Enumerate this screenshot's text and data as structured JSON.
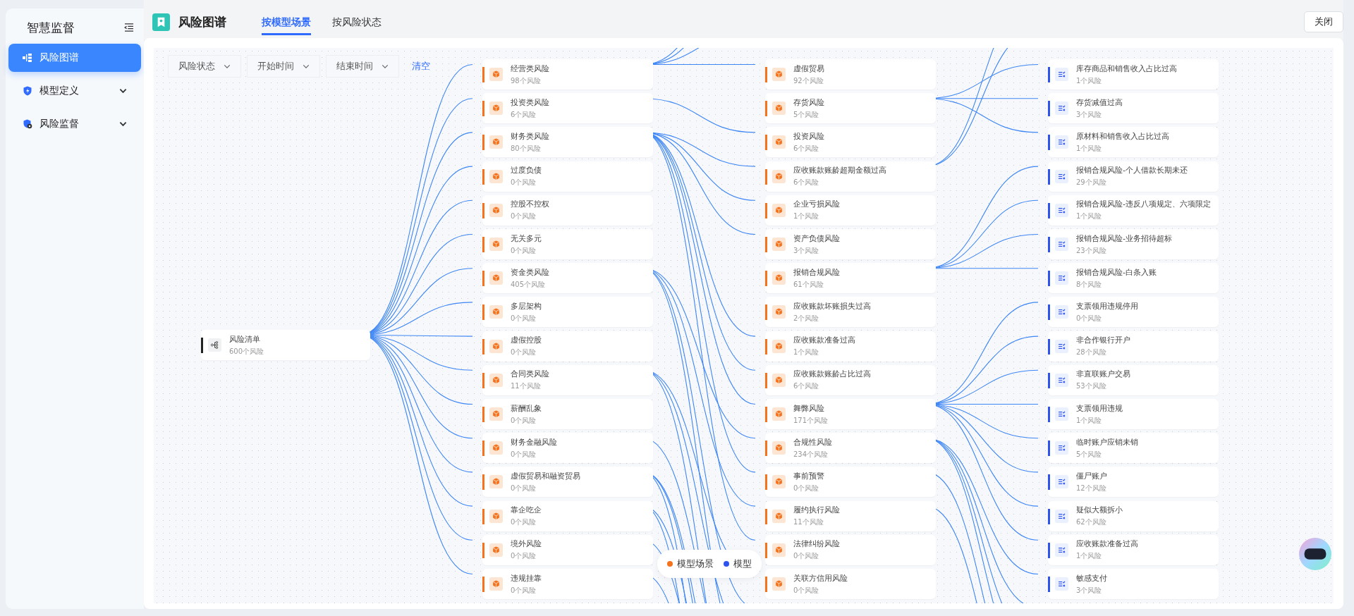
{
  "sidebar": {
    "title": "智慧监督",
    "items": [
      {
        "label": "风险图谱",
        "selected": true,
        "expandable": false
      },
      {
        "label": "模型定义",
        "selected": false,
        "expandable": true
      },
      {
        "label": "风险监督",
        "selected": false,
        "expandable": true
      }
    ]
  },
  "header": {
    "title": "风险图谱",
    "tabs": [
      {
        "label": "按模型场景",
        "selected": true
      },
      {
        "label": "按风险状态",
        "selected": false
      }
    ],
    "close": "关闭"
  },
  "filters": [
    {
      "label": "风险状态"
    },
    {
      "label": "开始时间"
    },
    {
      "label": "结束时间"
    }
  ],
  "clear": "清空",
  "graph": {
    "root": {
      "name": "风险清单",
      "count": "600个风险"
    },
    "columns": [
      {
        "kind": "scene",
        "nodes": [
          {
            "name": "经营类风险",
            "count": "98个风险"
          },
          {
            "name": "投资类风险",
            "count": "6个风险"
          },
          {
            "name": "财务类风险",
            "count": "80个风险"
          },
          {
            "name": "过度负债",
            "count": "0个风险"
          },
          {
            "name": "控股不控权",
            "count": "0个风险"
          },
          {
            "name": "无关多元",
            "count": "0个风险"
          },
          {
            "name": "资金类风险",
            "count": "405个风险"
          },
          {
            "name": "多层架构",
            "count": "0个风险"
          },
          {
            "name": "虚假控股",
            "count": "0个风险"
          },
          {
            "name": "合同类风险",
            "count": "11个风险"
          },
          {
            "name": "薪酬乱象",
            "count": "0个风险"
          },
          {
            "name": "财务金融风险",
            "count": "0个风险"
          },
          {
            "name": "虚假贸易和融资贸易",
            "count": "0个风险"
          },
          {
            "name": "靠企吃企",
            "count": "0个风险"
          },
          {
            "name": "境外风险",
            "count": "0个风险"
          },
          {
            "name": "违规挂靠",
            "count": "0个风险"
          }
        ]
      },
      {
        "kind": "scene",
        "nodes": [
          {
            "name": "虚假贸易",
            "count": "92个风险"
          },
          {
            "name": "存货风险",
            "count": "5个风险"
          },
          {
            "name": "投资风险",
            "count": "6个风险"
          },
          {
            "name": "应收账款账龄超期金额过高",
            "count": "6个风险"
          },
          {
            "name": "企业亏损风险",
            "count": "1个风险"
          },
          {
            "name": "资产负债风险",
            "count": "3个风险"
          },
          {
            "name": "报销合规风险",
            "count": "61个风险"
          },
          {
            "name": "应收账款坏账损失过高",
            "count": "2个风险"
          },
          {
            "name": "应收账款准备过高",
            "count": "1个风险"
          },
          {
            "name": "应收账款账龄占比过高",
            "count": "6个风险"
          },
          {
            "name": "舞弊风险",
            "count": "171个风险"
          },
          {
            "name": "合规性风险",
            "count": "234个风险"
          },
          {
            "name": "事前预警",
            "count": "0个风险"
          },
          {
            "name": "履约执行风险",
            "count": "11个风险"
          },
          {
            "name": "法律纠纷风险",
            "count": "0个风险"
          },
          {
            "name": "关联方信用风险",
            "count": "0个风险"
          }
        ]
      },
      {
        "kind": "model",
        "nodes": [
          {
            "name": "库存商品和销售收入占比过高",
            "count": "1个风险"
          },
          {
            "name": "存货减值过高",
            "count": "3个风险"
          },
          {
            "name": "原材料和销售收入占比过高",
            "count": "1个风险"
          },
          {
            "name": "报销合规风险-个人借款长期未还",
            "count": "29个风险"
          },
          {
            "name": "报销合规风险-违反八项规定、六项限定",
            "count": "1个风险"
          },
          {
            "name": "报销合规风险-业务招待超标",
            "count": "23个风险"
          },
          {
            "name": "报销合规风险-白条入账",
            "count": "8个风险"
          },
          {
            "name": "支票领用违规停用",
            "count": "0个风险"
          },
          {
            "name": "非合作银行开户",
            "count": "28个风险"
          },
          {
            "name": "非直联账户交易",
            "count": "53个风险"
          },
          {
            "name": "支票领用违规",
            "count": "1个风险"
          },
          {
            "name": "临时账户应销未销",
            "count": "5个风险"
          },
          {
            "name": "僵尸账户",
            "count": "12个风险"
          },
          {
            "name": "疑似大额拆小",
            "count": "62个风险"
          },
          {
            "name": "应收账款准备过高",
            "count": "1个风险"
          },
          {
            "name": "敏感支付",
            "count": "3个风险"
          }
        ]
      }
    ]
  },
  "legend": [
    {
      "label": "模型场景",
      "color": "#f5731d"
    },
    {
      "label": "模型",
      "color": "#2f54eb"
    }
  ]
}
